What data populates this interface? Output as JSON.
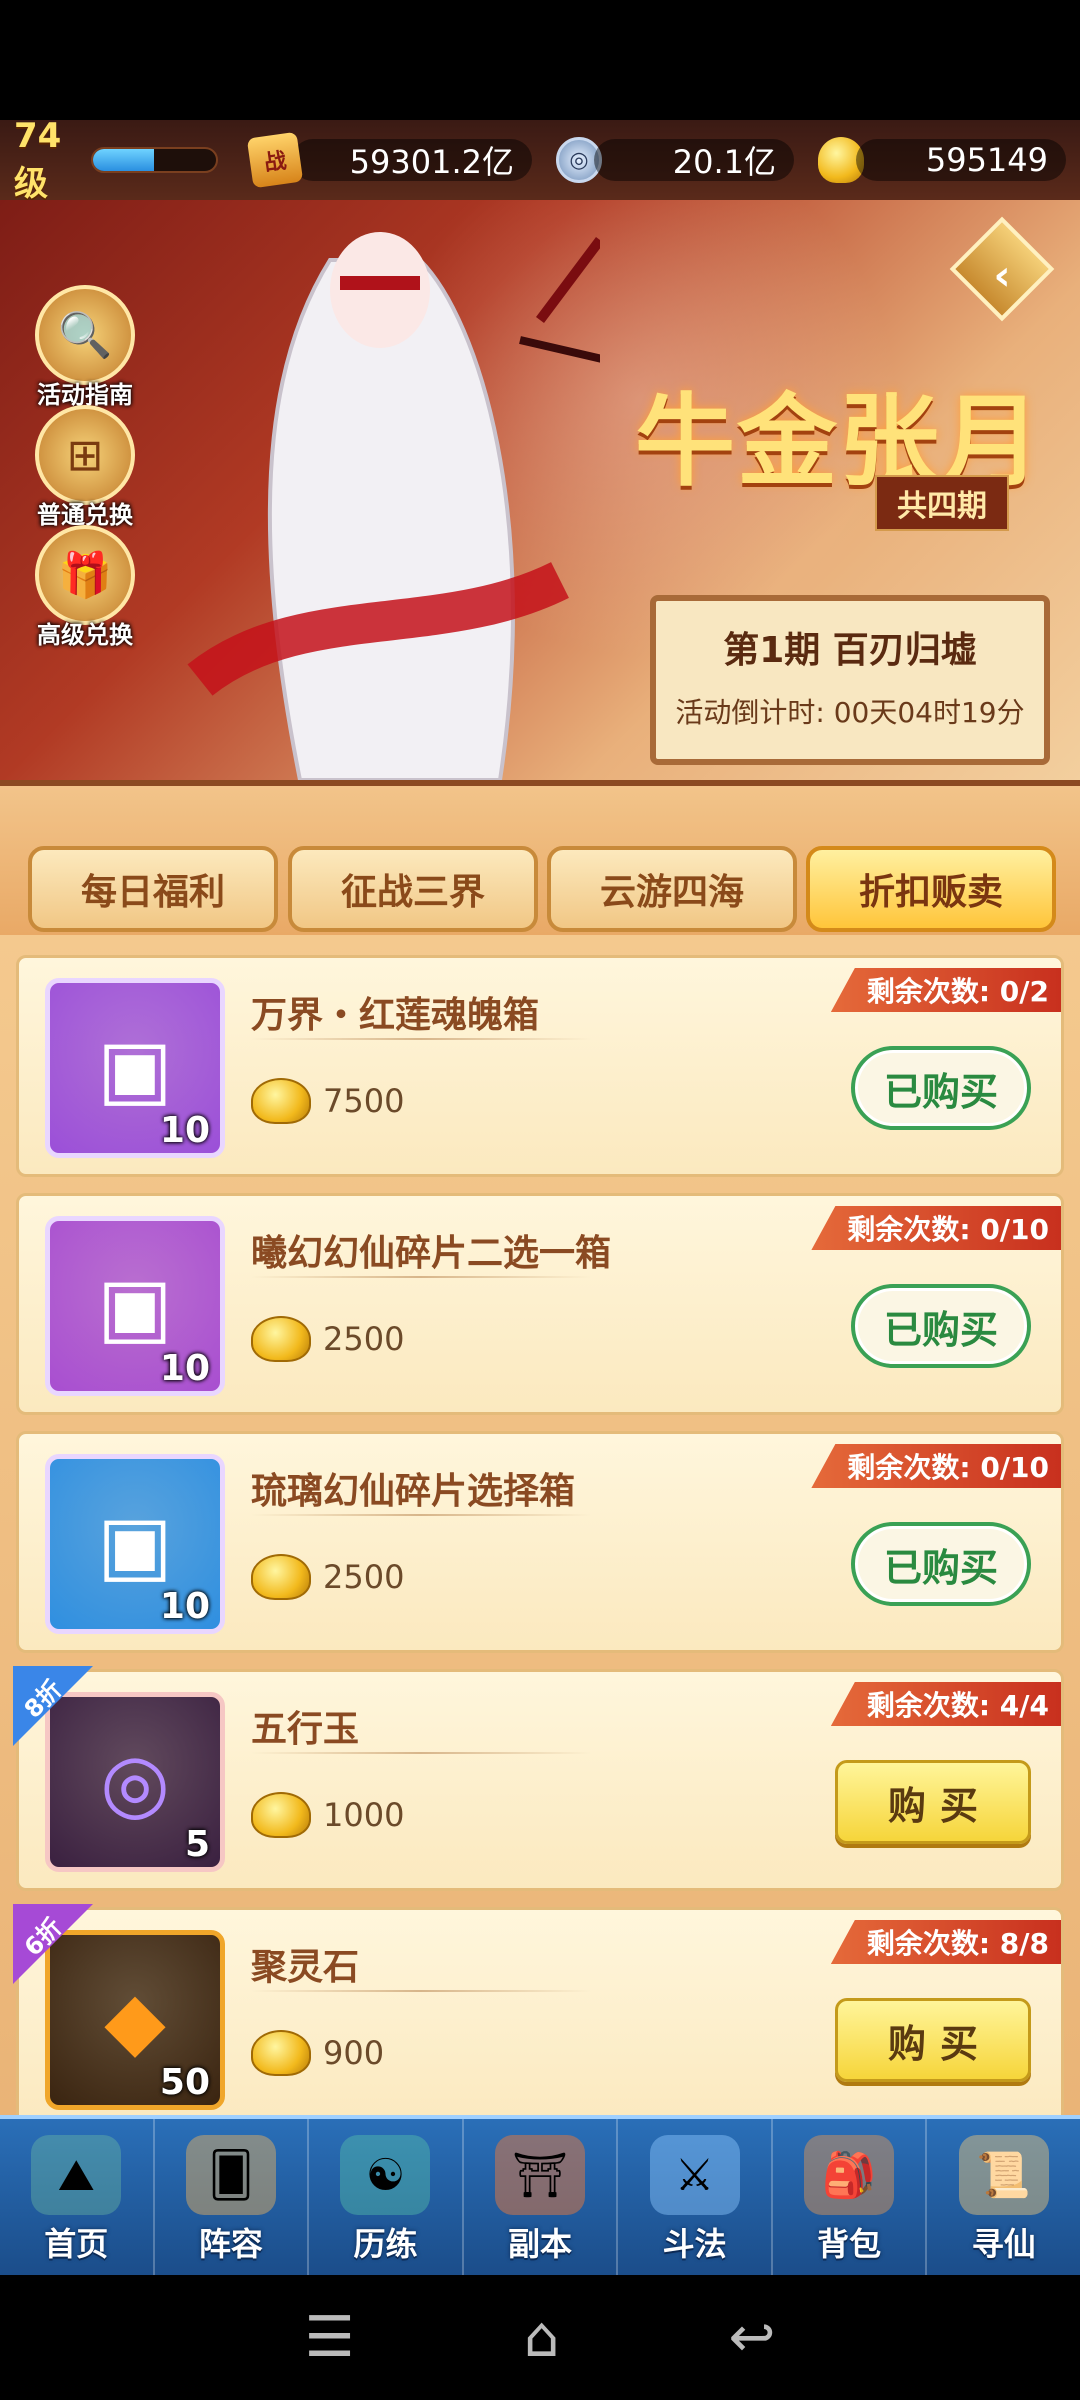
{
  "player": {
    "level": "74级",
    "xp_fraction": 0.5
  },
  "resources": [
    {
      "icon": "battle-power-icon",
      "symbol": "战",
      "value": "59301.2亿"
    },
    {
      "icon": "copper-coin-icon",
      "symbol": "◎",
      "value": "20.1亿"
    },
    {
      "icon": "gold-ingot-icon",
      "symbol": "",
      "value": "595149"
    }
  ],
  "side_buttons": [
    {
      "label": "活动指南",
      "icon": "magnifier-icon",
      "glyph": "🔍"
    },
    {
      "label": "普通兑换",
      "icon": "chest-icon",
      "glyph": "⊞"
    },
    {
      "label": "高级兑换",
      "icon": "gift-icon",
      "glyph": "🎁"
    }
  ],
  "event": {
    "title": "牛金张月",
    "subtitle": "共四期",
    "period": "第1期  百刃归墟",
    "countdown": "活动倒计时: 00天04时19分"
  },
  "tabs": [
    "每日福利",
    "征战三界",
    "云游四海",
    "折扣贩卖"
  ],
  "active_tab": 3,
  "items": [
    {
      "name": "万界・红莲魂魄箱",
      "price": "7500",
      "remain": "剩余次数: 0/2",
      "qty": "10",
      "status": "已购买",
      "discount": "",
      "thumb_color": "#9b4fd8"
    },
    {
      "name": "曦幻幻仙碎片二选一箱",
      "price": "2500",
      "remain": "剩余次数: 0/10",
      "qty": "10",
      "status": "已购买",
      "discount": "",
      "thumb_color": "#a84ed0"
    },
    {
      "name": "琉璃幻仙碎片选择箱",
      "price": "2500",
      "remain": "剩余次数: 0/10",
      "qty": "10",
      "status": "已购买",
      "discount": "",
      "thumb_color": "#2f8fe0"
    },
    {
      "name": "五行玉",
      "price": "1000",
      "remain": "剩余次数: 4/4",
      "qty": "5",
      "status": "购买",
      "discount": "8折",
      "thumb_color": "#3a2040"
    },
    {
      "name": "聚灵石",
      "price": "900",
      "remain": "剩余次数: 8/8",
      "qty": "50",
      "status": "购买",
      "discount": "6折",
      "thumb_color": "#3a2410"
    }
  ],
  "bottom_nav": [
    {
      "label": "首页",
      "icon": "home-icon",
      "glyph": "⛰"
    },
    {
      "label": "阵容",
      "icon": "cards-icon",
      "glyph": "🂠"
    },
    {
      "label": "历练",
      "icon": "training-icon",
      "glyph": "☯"
    },
    {
      "label": "副本",
      "icon": "gate-icon",
      "glyph": "⛩"
    },
    {
      "label": "斗法",
      "icon": "sword-icon",
      "glyph": "⚔"
    },
    {
      "label": "背包",
      "icon": "bag-icon",
      "glyph": "🎒"
    },
    {
      "label": "寻仙",
      "icon": "scroll-icon",
      "glyph": "📜"
    }
  ],
  "system_nav": {
    "menu": "☰",
    "home": "⌂",
    "back": "↩"
  }
}
